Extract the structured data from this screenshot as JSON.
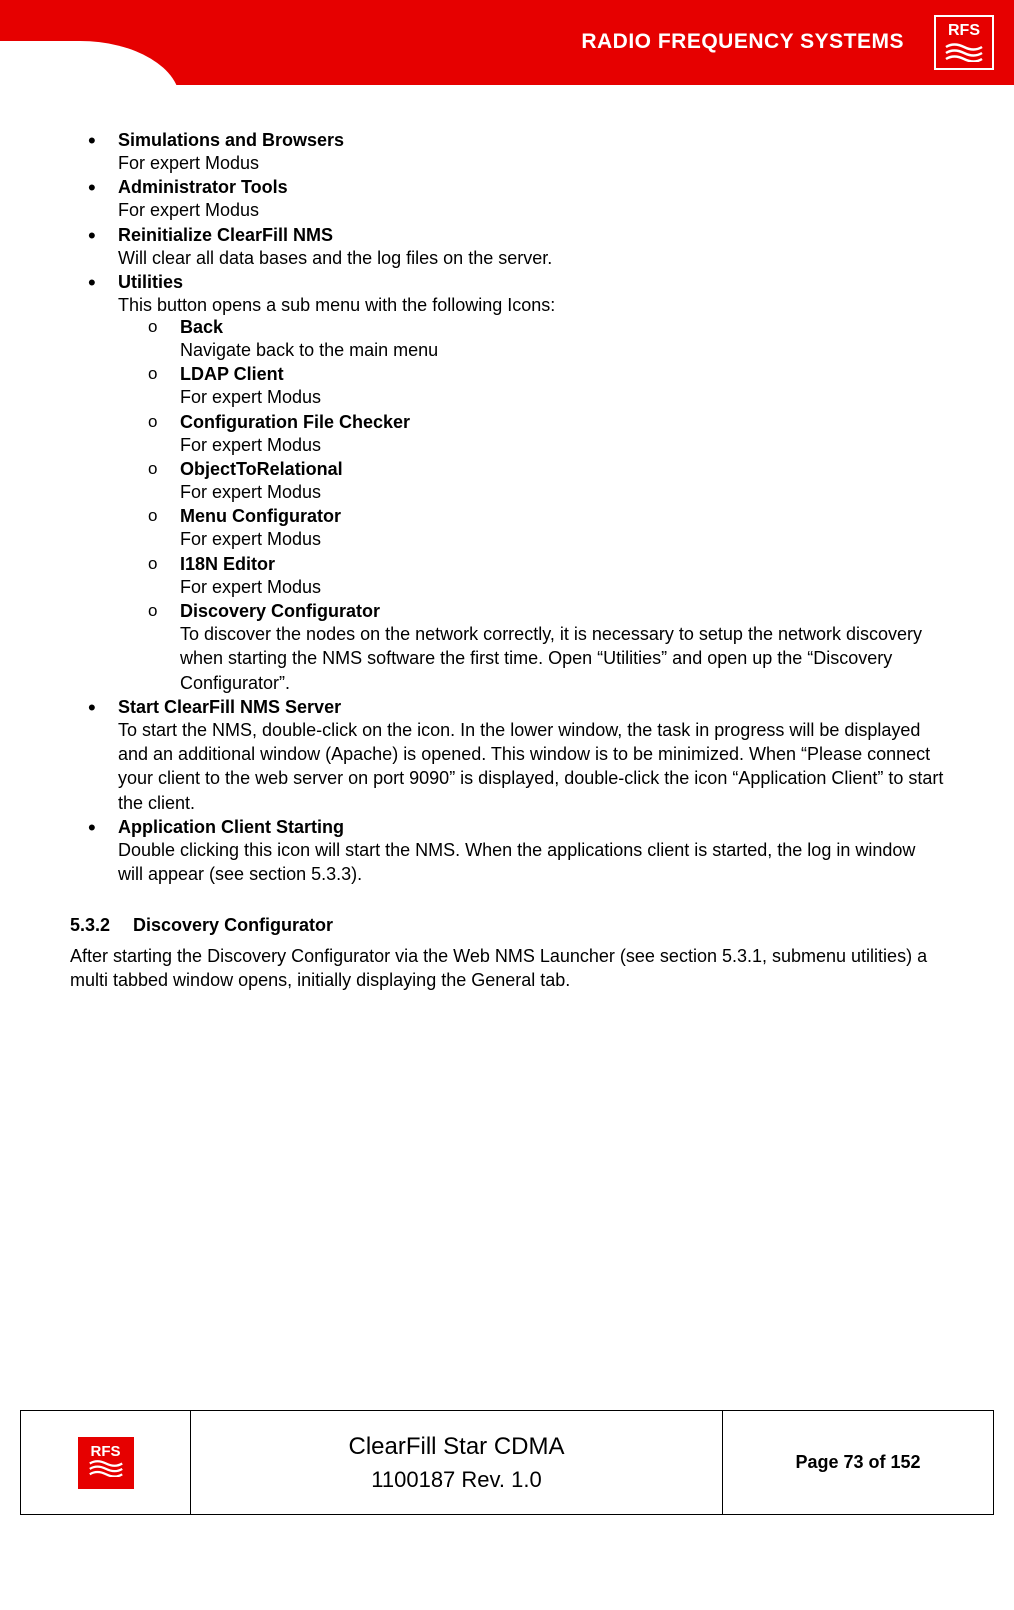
{
  "header": {
    "brand_text": "RADIO FREQUENCY SYSTEMS",
    "logo_text": "RFS"
  },
  "list": [
    {
      "title": "Simulations and Browsers",
      "desc": "For expert Modus"
    },
    {
      "title": "Administrator Tools",
      "desc": "For expert Modus"
    },
    {
      "title": "Reinitialize ClearFill NMS",
      "desc": "Will clear all data bases and the log files on the server."
    },
    {
      "title": "Utilities",
      "desc": "This button opens a sub menu with the following Icons:",
      "sub": [
        {
          "title": "Back",
          "desc": "Navigate back to the main menu"
        },
        {
          "title": "LDAP Client",
          "desc": "For expert Modus"
        },
        {
          "title": "Configuration File Checker",
          "desc": "For expert Modus"
        },
        {
          "title": "ObjectToRelational",
          "desc": "For expert Modus"
        },
        {
          "title": "Menu Configurator",
          "desc": "For expert Modus"
        },
        {
          "title": "I18N Editor",
          "desc": "For expert Modus"
        },
        {
          "title": "Discovery Configurator",
          "desc": "To discover the nodes on the network correctly, it is necessary to setup the network discovery when starting the NMS software the first time. Open “Utilities” and open up the “Discovery Configurator”."
        }
      ]
    },
    {
      "title": "Start ClearFill NMS Server",
      "desc": "To start the NMS, double-click on the icon. In the lower window, the task in progress will be displayed and an additional window (Apache) is opened. This window is to be minimized.  When “Please connect your client to the web server on port 9090” is displayed, double-click the icon “Application Client” to start the client."
    },
    {
      "title": "Application Client Starting",
      "desc": "Double clicking this icon will start the NMS.  When the applications client is started, the log in window will appear (see section 5.3.3)."
    }
  ],
  "section": {
    "number": "5.3.2",
    "title": "Discovery Configurator",
    "body": "After starting the Discovery Configurator via the Web NMS Launcher (see section 5.3.1, submenu utilities) a multi tabbed window opens, initially displaying the General tab."
  },
  "footer": {
    "logo_text": "RFS",
    "title": "ClearFill Star CDMA",
    "rev": "1100187 Rev. 1.0",
    "page": "Page 73 of 152"
  }
}
